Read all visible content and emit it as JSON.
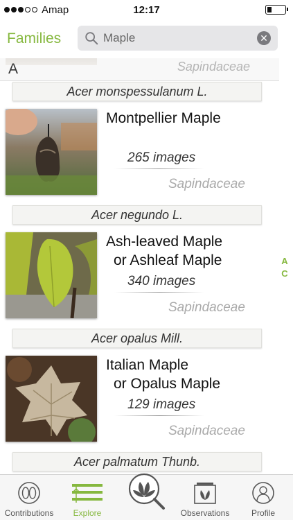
{
  "status_bar": {
    "carrier": "Amap",
    "time": "12:17",
    "battery_level": 0.25
  },
  "header": {
    "title": "Families",
    "search_value": "Maple"
  },
  "section": {
    "letter": "A",
    "partial_family": "Sapindaceae"
  },
  "species": [
    {
      "latin": "Acer monspessulanum L.",
      "common_line1": "Montpellier Maple",
      "common_line2": "",
      "count": "265 images",
      "family": "Sapindaceae"
    },
    {
      "latin": "Acer negundo L.",
      "common_line1": "Ash-leaved Maple",
      "common_line2": "or Ashleaf Maple",
      "count": "340 images",
      "family": "Sapindaceae"
    },
    {
      "latin": "Acer opalus Mill.",
      "common_line1": "Italian Maple",
      "common_line2": "or Opalus Maple",
      "count": "129 images",
      "family": "Sapindaceae"
    },
    {
      "latin": "Acer palmatum Thunb."
    }
  ],
  "index": [
    "A",
    "C"
  ],
  "tabs": [
    {
      "label": "Contributions",
      "icon": "contributions-icon"
    },
    {
      "label": "Explore",
      "icon": "explore-icon"
    },
    {
      "label": "",
      "icon": "identify-icon"
    },
    {
      "label": "Observations",
      "icon": "observations-icon"
    },
    {
      "label": "Profile",
      "icon": "profile-icon"
    }
  ],
  "colors": {
    "accent": "#86b83f",
    "search_bg": "#e6e6e8",
    "family_text": "#aaaaaa"
  }
}
